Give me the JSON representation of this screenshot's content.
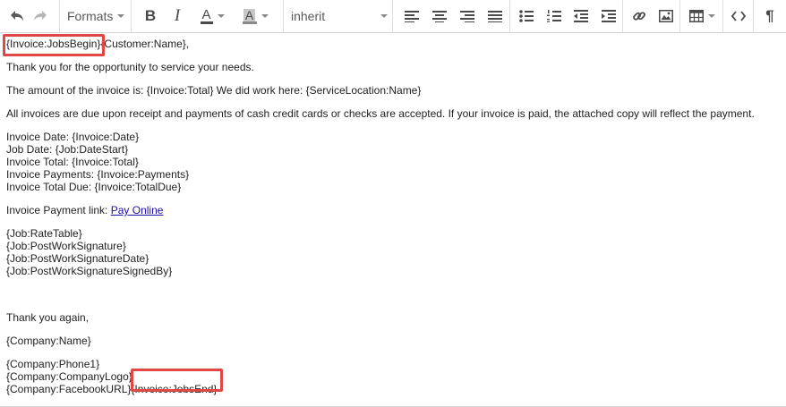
{
  "toolbar": {
    "formats_label": "Formats",
    "font_label": "inherit",
    "icons": [
      "undo-icon",
      "redo-icon",
      "bold-icon",
      "italic-icon",
      "text-color-icon",
      "background-color-icon",
      "align-left-icon",
      "align-center-icon",
      "align-right-icon",
      "align-justify-icon",
      "bullet-list-icon",
      "numbered-list-icon",
      "outdent-icon",
      "indent-icon",
      "link-icon",
      "image-icon",
      "table-icon",
      "source-code-icon",
      "paragraph-mark-icon"
    ]
  },
  "content": {
    "line1_token_begin": "{Invoice:JobsBegin}",
    "line1_rest": "{Customer:Name},",
    "thanks": "Thank you for the opportunity to service your needs.",
    "amount": "The amount of the invoice is: {Invoice:Total}  We did work here: {ServiceLocation:Name}",
    "terms": "All invoices are due upon receipt and payments of cash credit cards or checks are accepted. If your invoice is paid, the attached copy will reflect the payment.",
    "invoice_lines": [
      "Invoice Date: {Invoice:Date}",
      "Job Date: {Job:DateStart}",
      "Invoice Total: {Invoice:Total}",
      "Invoice Payments: {Invoice:Payments}",
      "Invoice Total Due: {Invoice:TotalDue}"
    ],
    "payment_prefix": "Invoice Payment link: ",
    "payment_link": "Pay Online",
    "job_lines": [
      "{Job:RateTable}",
      "{Job:PostWorkSignature}",
      "{Job:PostWorkSignatureDate}",
      "{Job:PostWorkSignatureSignedBy}"
    ],
    "thanks_again": "Thank you again,",
    "company_name": "{Company:Name}",
    "company_lines": [
      "{Company:Phone1}",
      "{Company:CompanyLogo}"
    ],
    "last_line_start": "{Company:FacebookURL}",
    "last_token_end": "{Invoice:JobsEnd}"
  },
  "colors": {
    "highlight": "#e04848",
    "link": "#1a0dab",
    "icon": "#595959"
  }
}
